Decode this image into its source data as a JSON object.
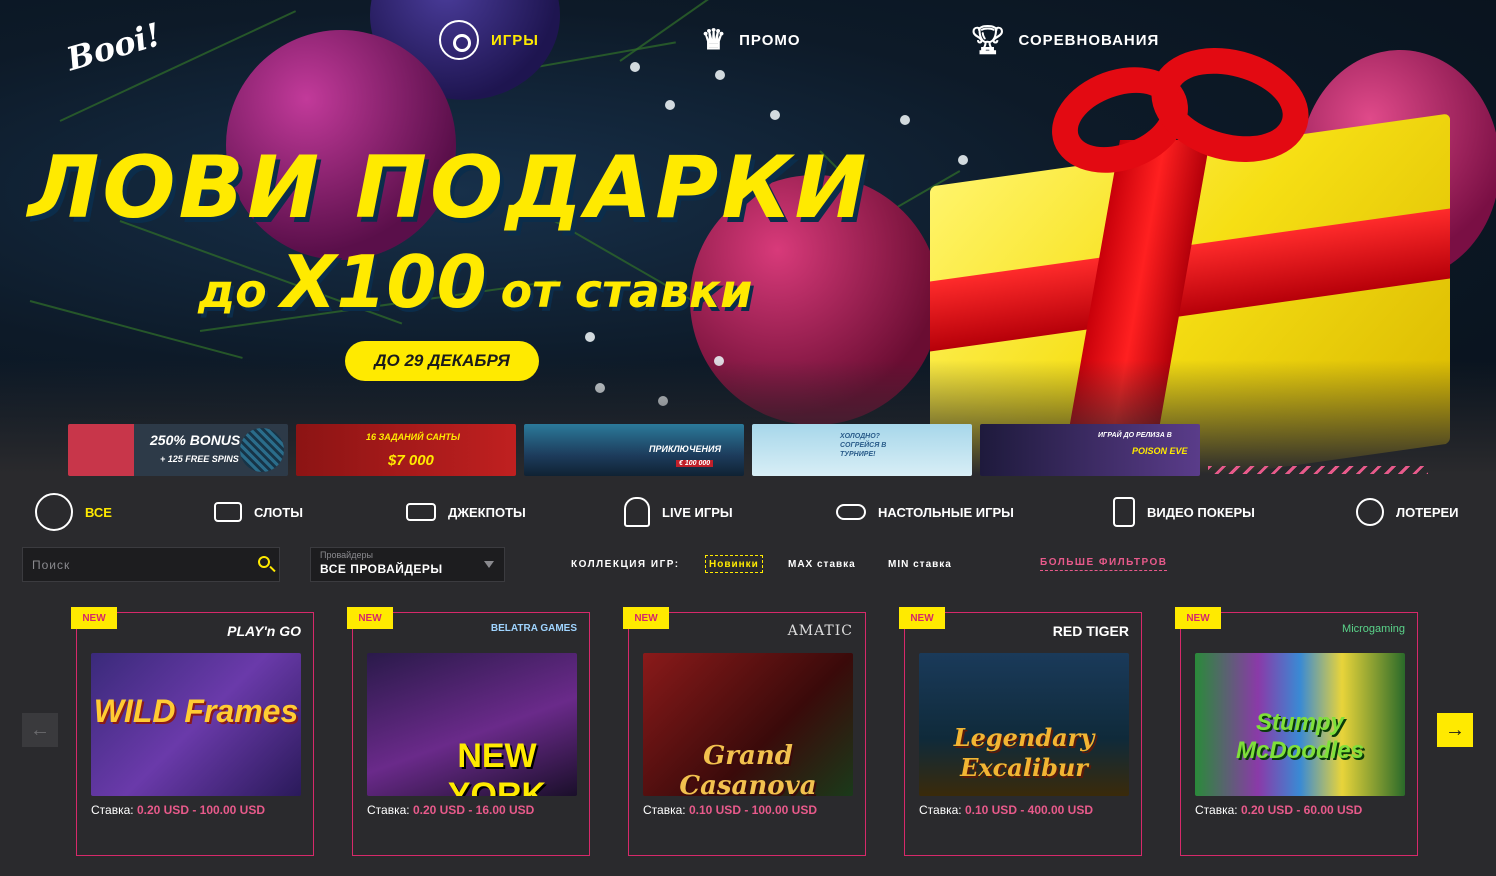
{
  "brand": {
    "logo_text": "Booi!"
  },
  "topnav": [
    {
      "label": "ИГРЫ",
      "icon": "roulette-icon",
      "active": true
    },
    {
      "label": "ПРОМО",
      "icon": "crown-icon",
      "active": false
    },
    {
      "label": "СОРЕВНОВАНИЯ",
      "icon": "trophy-icon",
      "active": false
    }
  ],
  "hero": {
    "headline": "ЛОВИ ПОДАРКИ",
    "sub_prefix": "до",
    "sub_multiplier": "X100",
    "sub_suffix": "от ставки",
    "date_button": "ДО 29 ДЕКАБРЯ"
  },
  "promos": [
    {
      "text": "250% BONUS",
      "sub": "+ 125 FREE SPINS"
    },
    {
      "text": "16 ЗАДАНИЙ САНТЫ",
      "sub": "$7 000"
    },
    {
      "text": "ПРИКЛЮЧЕНИЯ",
      "sub": "€ 100 000"
    },
    {
      "text": "ХОЛОДНО? СОГРЕЙСЯ В ТУРНИРЕ!",
      "sub": ""
    },
    {
      "text": "ИГРАЙ ДО РЕЛИЗА В",
      "sub": "POISON EVE"
    }
  ],
  "categories": [
    {
      "label": "ВСЕ",
      "icon": "all-games-icon",
      "active": true
    },
    {
      "label": "СЛОТЫ",
      "icon": "slot-machine-icon",
      "active": false
    },
    {
      "label": "ДЖЕКПОТЫ",
      "icon": "jackpot-icon",
      "active": false
    },
    {
      "label": "LIVE ИГРЫ",
      "icon": "live-dealer-icon",
      "active": false
    },
    {
      "label": "НАСТОЛЬНЫЕ ИГРЫ",
      "icon": "table-games-icon",
      "active": false
    },
    {
      "label": "ВИДЕО ПОКЕРЫ",
      "icon": "video-poker-icon",
      "active": false
    },
    {
      "label": "ЛОТЕРЕИ",
      "icon": "ferris-wheel-icon",
      "active": false
    }
  ],
  "filters": {
    "search_placeholder": "Поиск",
    "provider_label": "Провайдеры",
    "provider_value": "ВСЕ ПРОВАЙДЕРЫ",
    "collection_label": "КОЛЛЕКЦИЯ ИГР:",
    "chips": [
      {
        "label": "Новинки",
        "active": true
      },
      {
        "label": "MAX ставка",
        "active": false
      },
      {
        "label": "MIN ставка",
        "active": false
      }
    ],
    "more_filters": "БОЛЬШЕ ФИЛЬТРОВ"
  },
  "games": [
    {
      "badge": "NEW",
      "provider": "PLAY'n GO",
      "title": "WILD Frames",
      "stake_label": "Ставка:",
      "stake_value": "0.20 USD - 100.00 USD"
    },
    {
      "badge": "NEW",
      "provider": "BELATRA GAMES",
      "title": "NEW YORK",
      "stake_label": "Ставка:",
      "stake_value": "0.20 USD - 16.00 USD"
    },
    {
      "badge": "NEW",
      "provider": "AMATIC",
      "title": "Grand Casanova",
      "stake_label": "Ставка:",
      "stake_value": "0.10 USD - 100.00 USD"
    },
    {
      "badge": "NEW",
      "provider": "RED TIGER",
      "title": "Legendary Excalibur",
      "stake_label": "Ставка:",
      "stake_value": "0.10 USD - 400.00 USD"
    },
    {
      "badge": "NEW",
      "provider": "Microgaming",
      "title": "Stumpy McDoodles",
      "stake_label": "Ставка:",
      "stake_value": "0.20 USD - 60.00 USD"
    }
  ],
  "carousel": {
    "prev_icon": "arrow-left-icon",
    "next_icon": "arrow-right-icon"
  },
  "colors": {
    "accent": "#ffea00",
    "pink": "#e85a8b",
    "card_border": "#d6296a",
    "background": "#2a2a2d"
  }
}
